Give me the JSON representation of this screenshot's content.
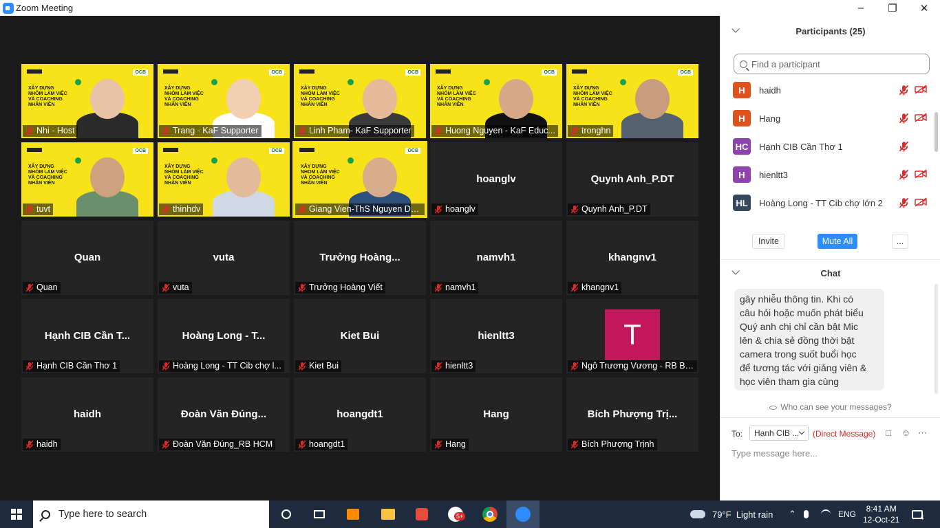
{
  "window": {
    "title": "Zoom Meeting"
  },
  "slide_text": {
    "brand": "KaF",
    "bank": "OCB",
    "headline": [
      "XÂY DỰNG",
      "NHÓM LÀM VIỆC",
      "VÀ COACHING",
      "NHÂN VIÊN"
    ]
  },
  "tiles": [
    {
      "name": "Nhi - Host",
      "video": true
    },
    {
      "name": "Trang - KaF Supporter",
      "video": true
    },
    {
      "name": "Linh Pham- KaF Supporter",
      "video": true
    },
    {
      "name": "Huong Nguyen - KaF Educ...",
      "video": true
    },
    {
      "name": "tronghn",
      "video": true
    },
    {
      "name": "tuvt",
      "video": true
    },
    {
      "name": "thinhdv",
      "video": true
    },
    {
      "name": "Giang Vien-ThS Nguyen Duy K...",
      "video": true,
      "active": true
    },
    {
      "name": "hoanglv",
      "display": "hoanglv"
    },
    {
      "name": "Quynh Anh_P.DT",
      "display": "Quynh Anh_P.DT"
    },
    {
      "name": "Quan",
      "display": "Quan"
    },
    {
      "name": "vuta",
      "display": "vuta"
    },
    {
      "name": "Trưởng Hoàng Viết",
      "display": "Trưởng  Hoàng..."
    },
    {
      "name": "namvh1",
      "display": "namvh1"
    },
    {
      "name": "khangnv1",
      "display": "khangnv1"
    },
    {
      "name": "Hạnh CIB Cần Thơ 1",
      "display": "Hạnh CIB Cần T..."
    },
    {
      "name": "Hoàng Long - TT Cib chợ l...",
      "display": "Hoàng Long - T..."
    },
    {
      "name": "Kiet Bui",
      "display": "Kiet Bui"
    },
    {
      "name": "hienltt3",
      "display": "hienltt3"
    },
    {
      "name": "Ngô Trương Vương - RB Bì...",
      "avatar_letter": "T"
    },
    {
      "name": "haidh",
      "display": "haidh"
    },
    {
      "name": "Đoàn Văn Đúng_RB HCM",
      "display": "Đoàn Văn Đúng..."
    },
    {
      "name": "hoangdt1",
      "display": "hoangdt1"
    },
    {
      "name": "Hang",
      "display": "Hang"
    },
    {
      "name": "Bích Phượng Trịnh",
      "display": "Bích Phượng Trị..."
    }
  ],
  "participants": {
    "header": "Participants (25)",
    "search_placeholder": "Find a participant",
    "list": [
      {
        "initials": "H",
        "name": "haidh",
        "color": "#e0521b",
        "video_icon": true
      },
      {
        "initials": "H",
        "name": "Hang",
        "color": "#e0521b",
        "video_icon": true
      },
      {
        "initials": "HC",
        "name": "Hạnh CIB Cần Thơ 1",
        "color": "#8e44ad",
        "video_icon": false
      },
      {
        "initials": "H",
        "name": "hienltt3",
        "color": "#8e44ad",
        "video_icon": true
      },
      {
        "initials": "HL",
        "name": "Hoàng Long - TT Cib chợ lớn 2",
        "color": "#34495e",
        "video_icon": true
      }
    ],
    "invite_label": "Invite",
    "mute_all_label": "Mute All",
    "more_label": "..."
  },
  "chat": {
    "header": "Chat",
    "message_lines": [
      "gây nhiễu thông tin. Khi có",
      "câu hỏi hoặc muốn phát biểu",
      "Quý anh chị chỉ cần bật Mic",
      "lên & chia sẻ đồng thời bật",
      "camera trong suốt buổi học",
      "để tương tác với giảng viên &",
      "học viên tham gia cùng"
    ],
    "who_can_see": "Who can see your messages?",
    "to_label": "To:",
    "to_value": "Hạnh CIB ...",
    "direct_label": "(Direct Message)",
    "input_placeholder": "Type message here..."
  },
  "taskbar": {
    "search_placeholder": "Type here to search",
    "badge": "5+",
    "weather": "79°F  Light rain",
    "language": "ENG",
    "time": "8:41 AM",
    "date": "12-Oct-21",
    "notifications": "4"
  },
  "colors": {
    "accent": "#2d8cff",
    "mic_muted": "#e02828",
    "slide_yellow": "#f8e31a",
    "active_border": "#f5e000"
  }
}
